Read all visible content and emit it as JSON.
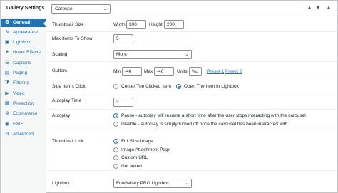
{
  "header": {
    "title": "Gallery Settings",
    "title_caret": "▾",
    "template_select": "Carousel",
    "controls": [
      "▲",
      "▼",
      "▲"
    ]
  },
  "sidebar": {
    "items": [
      {
        "label": "General",
        "icon": "gear-icon",
        "glyph": "⚙",
        "active": true
      },
      {
        "label": "Appearance",
        "icon": "brush-icon",
        "glyph": "✎",
        "active": false
      },
      {
        "label": "Lightbox",
        "icon": "lightbox-icon",
        "glyph": "▣",
        "active": false
      },
      {
        "label": "Hover Effects",
        "icon": "hover-icon",
        "glyph": "✦",
        "active": false
      },
      {
        "label": "Captions",
        "icon": "captions-icon",
        "glyph": "☰",
        "active": false
      },
      {
        "label": "Paging",
        "icon": "paging-icon",
        "glyph": "▤",
        "active": false
      },
      {
        "label": "Filtering",
        "icon": "filter-icon",
        "glyph": "⧩",
        "active": false
      },
      {
        "label": "Video",
        "icon": "video-icon",
        "glyph": "▶",
        "active": false
      },
      {
        "label": "Protection",
        "icon": "lock-icon",
        "glyph": "▦",
        "active": false
      },
      {
        "label": "Ecommerce",
        "icon": "cart-icon",
        "glyph": "⊕",
        "active": false
      },
      {
        "label": "EXIF",
        "icon": "camera-icon",
        "glyph": "◉",
        "active": false
      },
      {
        "label": "Advanced",
        "icon": "advanced-gear-icon",
        "glyph": "⚙",
        "active": false
      }
    ]
  },
  "fields": {
    "thumbnail_size": {
      "label": "Thumbnail Size",
      "width_label": "Width",
      "width": "300",
      "height_label": "Height",
      "height": "200"
    },
    "max_items": {
      "label": "Max Items To Show",
      "value": "5"
    },
    "scaling": {
      "label": "Scaling",
      "value": "More"
    },
    "gutters": {
      "label": "Gutters",
      "min_label": "Min",
      "min": "-40",
      "max_label": "Max",
      "max": "-40",
      "units": "Units",
      "units_value": "%",
      "preset1": "Preset 1",
      "preset2": "Preset 2"
    },
    "side_items_click": {
      "label": "Side Items Click",
      "options": [
        "Center The Clicked Item",
        "Open The Item In Lightbox"
      ],
      "selected": 1
    },
    "autoplay_time": {
      "label": "Autoplay Time",
      "value": "3"
    },
    "autoplay": {
      "label": "Autoplay",
      "options": [
        "Pause - autoplay will resume a short time after the user stops interacting with the carousel",
        "Disable - autoplay is simply turned off once the carousel has been interacted with"
      ],
      "selected": 0
    },
    "thumbnail_link": {
      "label": "Thumbnail Link",
      "options": [
        "Full Size Image",
        "Image Attachment Page",
        "Custom URL",
        "Not linked"
      ],
      "selected": 0
    },
    "lightbox": {
      "label": "Lightbox",
      "value": "FooGallery PRO Lightbox"
    }
  },
  "colors": {
    "accent": "#2271b1",
    "sidebar_bg": "#f6f7f7",
    "border": "#c3c4c7"
  }
}
